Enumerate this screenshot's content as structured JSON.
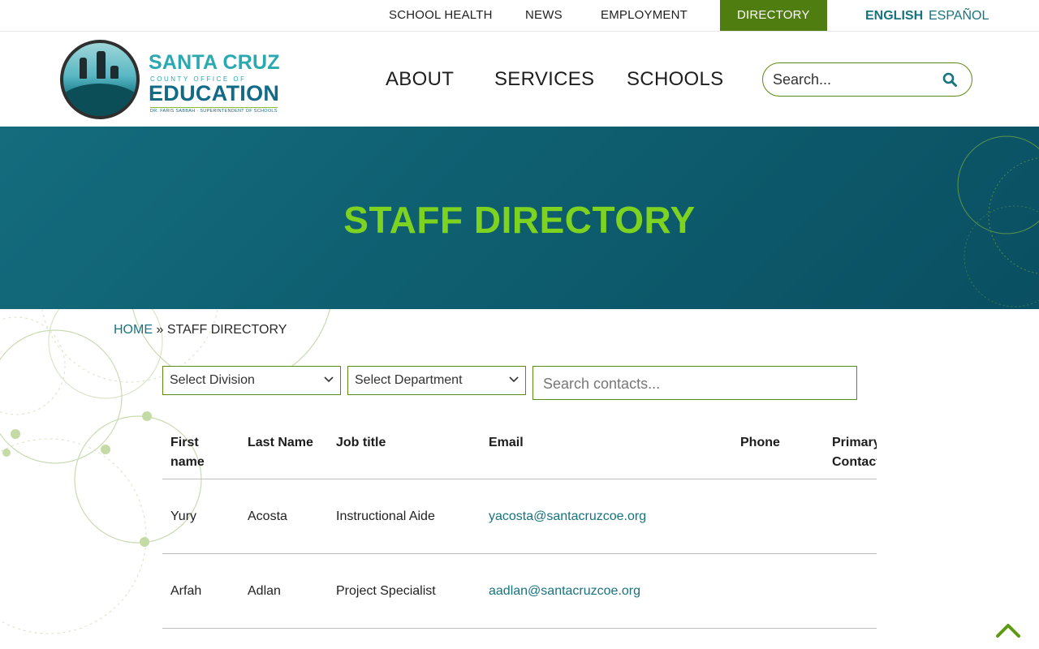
{
  "utility_nav": {
    "school_health": "SCHOOL HEALTH",
    "news": "NEWS",
    "employment": "EMPLOYMENT",
    "directory": "DIRECTORY"
  },
  "languages": {
    "english": "ENGLISH",
    "espanol": "ESPAÑOL"
  },
  "logo": {
    "line1": "SANTA CRUZ",
    "line2": "COUNTY OFFICE OF",
    "line3": "EDUCATION",
    "line4": "DR. FARIS SABBAH · SUPERINTENDENT OF SCHOOLS"
  },
  "main_nav": {
    "about": "ABOUT",
    "services": "SERVICES",
    "schools": "SCHOOLS"
  },
  "site_search": {
    "placeholder": "Search..."
  },
  "banner": {
    "title": "STAFF DIRECTORY"
  },
  "breadcrumb": {
    "home": "HOME",
    "separator": "»",
    "current": "STAFF DIRECTORY"
  },
  "filters": {
    "division": "Select Division",
    "department": "Select Department",
    "contact_search_placeholder": "Search contacts..."
  },
  "table": {
    "headers": {
      "first_name": "First name",
      "last_name": "Last Name",
      "job_title": "Job title",
      "email": "Email",
      "phone": "Phone",
      "primary_contact": "Primary Contact"
    },
    "rows": [
      {
        "first_name": "Yury",
        "last_name": "Acosta",
        "job_title": "Instructional Aide",
        "email": "yacosta@santacruzcoe.org",
        "phone": ""
      },
      {
        "first_name": "Arfah",
        "last_name": "Adlan",
        "job_title": "Project Specialist",
        "email": "aadlan@santacruzcoe.org",
        "phone": ""
      }
    ]
  },
  "colors": {
    "brand_teal": "#17737e",
    "brand_green": "#4f7d0f",
    "banner_title": "#7ed321"
  }
}
